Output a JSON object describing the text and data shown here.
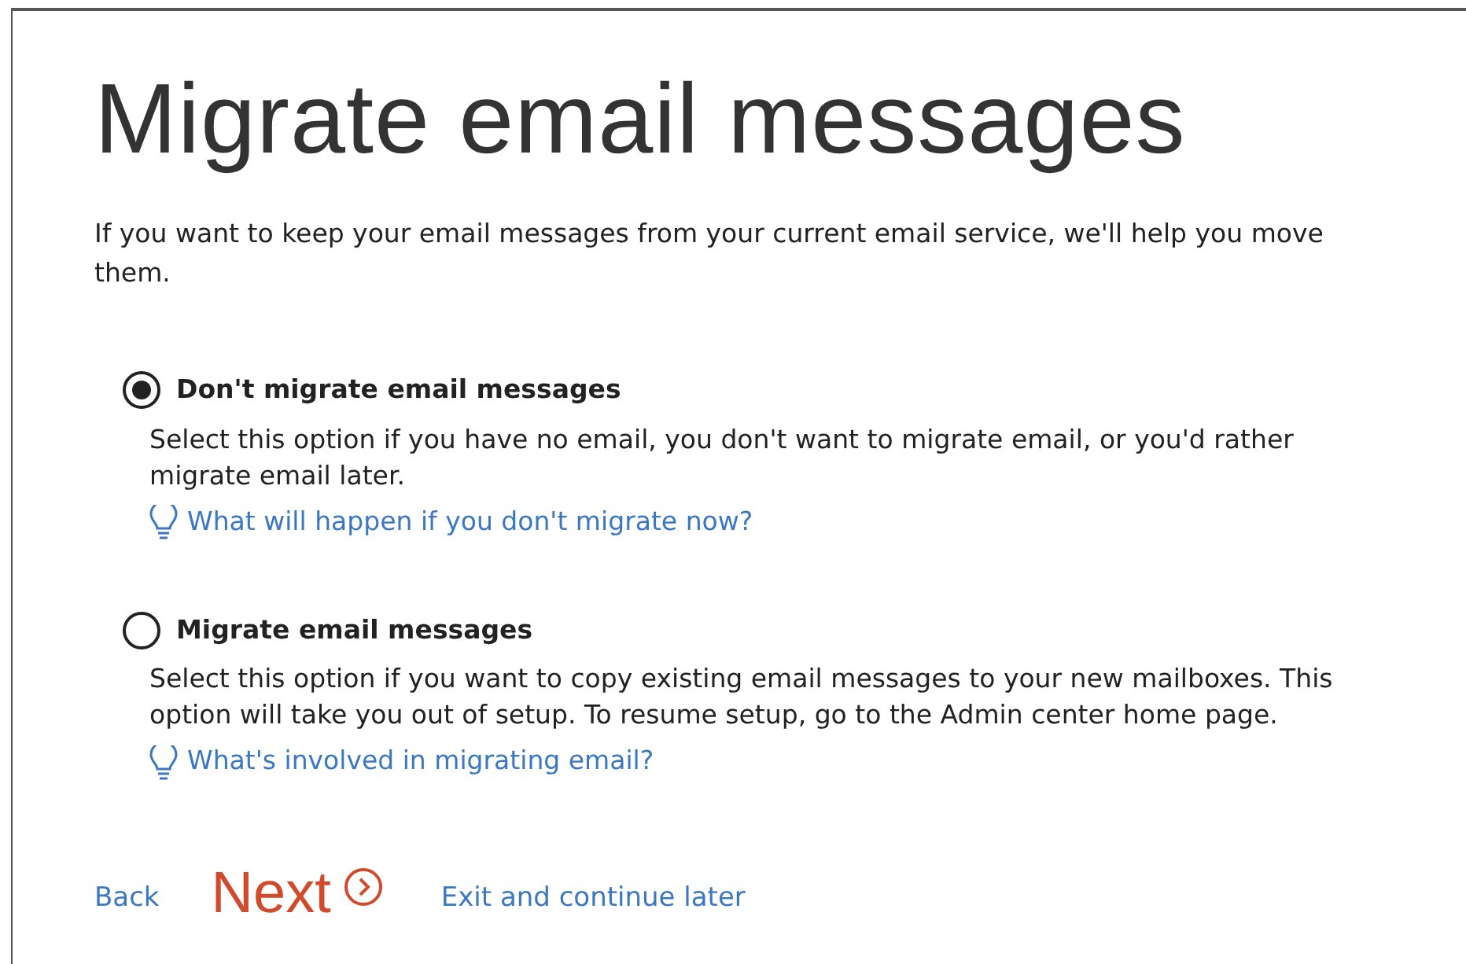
{
  "title": "Migrate email messages",
  "intro": "If you want to keep your email messages from your current email service, we'll help you move them.",
  "options": [
    {
      "label": "Don't migrate email messages",
      "selected": true,
      "description": "Select this option if you have no email, you don't want to migrate email, or you'd rather migrate email later.",
      "help_link": "What will happen if you don't migrate now?"
    },
    {
      "label": "Migrate email messages",
      "selected": false,
      "description": "Select this option if you want to copy existing email messages to your new mailboxes. This option will take you out of setup. To resume setup, go to the Admin center home page.",
      "help_link": "What's involved in migrating email?"
    }
  ],
  "footer": {
    "back": "Back",
    "next": "Next",
    "exit": "Exit and continue later"
  }
}
